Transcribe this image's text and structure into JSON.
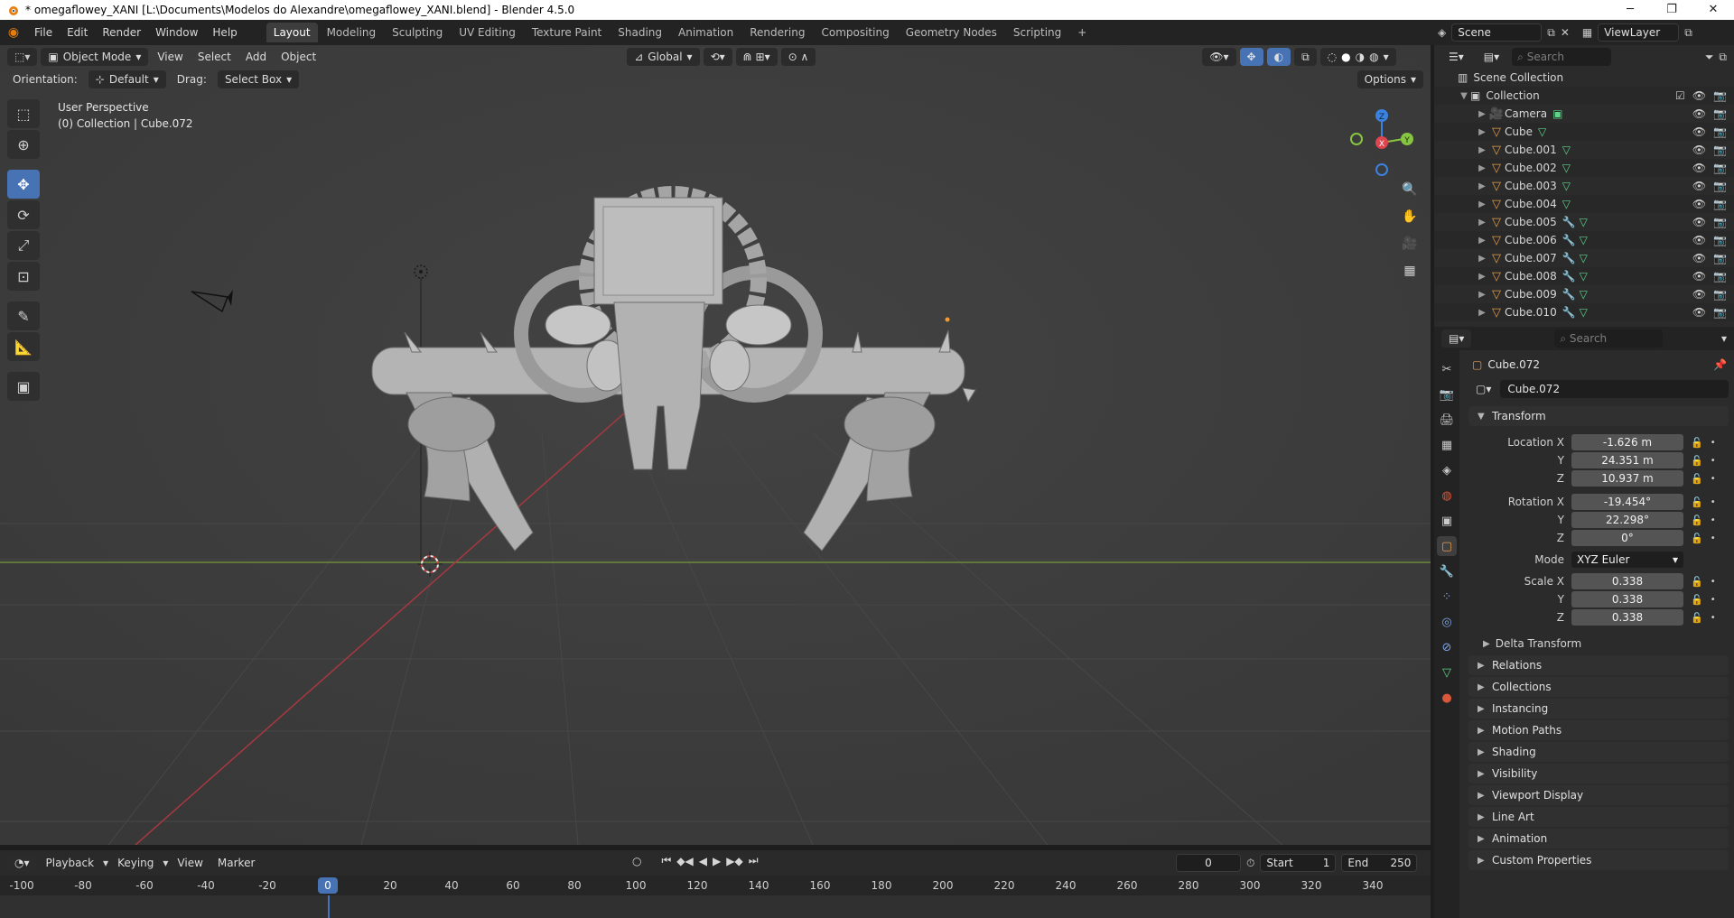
{
  "window": {
    "title": "* omegaflowey_XANI [L:\\Documents\\Modelos do Alexandre\\omegaflowey_XANI.blend] - Blender 4.5.0",
    "controls": [
      "─",
      "❐",
      "✕"
    ]
  },
  "menu": {
    "items": [
      "File",
      "Edit",
      "Render",
      "Window",
      "Help"
    ]
  },
  "workspaces": {
    "tabs": [
      "Layout",
      "Modeling",
      "Sculpting",
      "UV Editing",
      "Texture Paint",
      "Shading",
      "Animation",
      "Rendering",
      "Compositing",
      "Geometry Nodes",
      "Scripting"
    ],
    "add": "+"
  },
  "scene": {
    "name": "Scene",
    "view_layer": "ViewLayer"
  },
  "viewport": {
    "mode": "Object Mode",
    "menus": [
      "View",
      "Select",
      "Add",
      "Object"
    ],
    "transform_orientation": "Global",
    "orientation_label": "Orientation:",
    "orientation_value": "Default",
    "drag_label": "Drag:",
    "drag_value": "Select Box",
    "options": "Options",
    "info_line1": "User Perspective",
    "info_line2": "(0) Collection | Cube.072",
    "gizmo": {
      "z": "Z",
      "y": "Y",
      "x": "X"
    }
  },
  "timeline": {
    "menus": [
      "Playback",
      "Keying",
      "View",
      "Marker"
    ],
    "current_frame": "0",
    "start_label": "Start",
    "start": "1",
    "end_label": "End",
    "end": "250",
    "ruler": [
      "-100",
      "-80",
      "-60",
      "-40",
      "-20",
      "0",
      "20",
      "40",
      "60",
      "80",
      "100",
      "120",
      "140",
      "160",
      "180",
      "200",
      "220",
      "240",
      "260",
      "280",
      "300",
      "320",
      "340"
    ],
    "frame_marker": "0"
  },
  "outliner": {
    "search_placeholder": "Search",
    "scene_collection": "Scene Collection",
    "collection": "Collection",
    "objects": [
      {
        "name": "Camera",
        "type": "camera",
        "modifier": false
      },
      {
        "name": "Cube",
        "type": "mesh",
        "modifier": false
      },
      {
        "name": "Cube.001",
        "type": "mesh",
        "modifier": false
      },
      {
        "name": "Cube.002",
        "type": "mesh",
        "modifier": false
      },
      {
        "name": "Cube.003",
        "type": "mesh",
        "modifier": false
      },
      {
        "name": "Cube.004",
        "type": "mesh",
        "modifier": false
      },
      {
        "name": "Cube.005",
        "type": "mesh",
        "modifier": true
      },
      {
        "name": "Cube.006",
        "type": "mesh",
        "modifier": true
      },
      {
        "name": "Cube.007",
        "type": "mesh",
        "modifier": true
      },
      {
        "name": "Cube.008",
        "type": "mesh",
        "modifier": true
      },
      {
        "name": "Cube.009",
        "type": "mesh",
        "modifier": true
      },
      {
        "name": "Cube.010",
        "type": "mesh",
        "modifier": true
      }
    ]
  },
  "properties": {
    "search_placeholder": "Search",
    "object_title": "Cube.072",
    "object_name": "Cube.072",
    "transform_title": "Transform",
    "location": {
      "label_x": "Location X",
      "label_y": "Y",
      "label_z": "Z",
      "x": "-1.626 m",
      "y": "24.351 m",
      "z": "10.937 m"
    },
    "rotation": {
      "label_x": "Rotation X",
      "label_y": "Y",
      "label_z": "Z",
      "x": "-19.454°",
      "y": "22.298°",
      "z": "0°"
    },
    "mode_label": "Mode",
    "mode_value": "XYZ Euler",
    "scale": {
      "label_x": "Scale X",
      "label_y": "Y",
      "label_z": "Z",
      "x": "0.338",
      "y": "0.338",
      "z": "0.338"
    },
    "delta_transform": "Delta Transform",
    "panels": [
      "Relations",
      "Collections",
      "Instancing",
      "Motion Paths",
      "Shading",
      "Visibility",
      "Viewport Display",
      "Line Art",
      "Animation",
      "Custom Properties"
    ]
  },
  "colors": {
    "accent": "#4772b3",
    "object_orange": "#e59c4c",
    "mesh_green": "#5fd38a",
    "x_axis": "#e0444e",
    "y_axis": "#86c541",
    "z_axis": "#3b82e0"
  }
}
